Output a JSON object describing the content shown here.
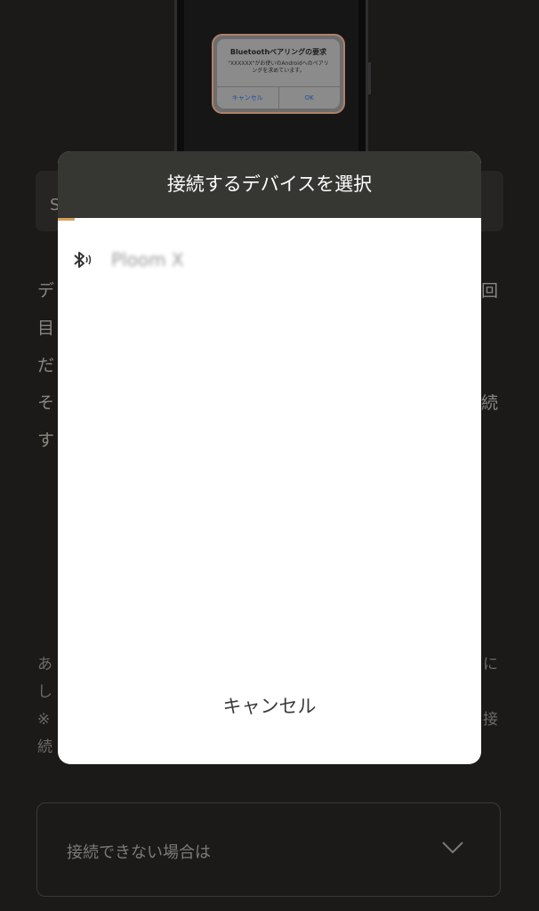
{
  "illustration": {
    "dialog_title": "Bluetoothペアリングの要求",
    "dialog_message": "\"XXXXXX\"がお使いのAndroidへのペアリングを求めています。",
    "cancel_label": "キャンセル",
    "ok_label": "OK"
  },
  "background": {
    "tab_text": "S",
    "paragraph_fragments": [
      "デ",
      "目",
      "だ",
      "そ",
      "す"
    ],
    "paragraph_right_fragments": [
      "回",
      "",
      "",
      "続",
      ""
    ],
    "note_fragments": [
      "あ",
      "し",
      "※",
      "続"
    ],
    "note_right_fragments": [
      "に",
      "",
      "接",
      ""
    ],
    "accordion_label": "接続できない場合は"
  },
  "modal": {
    "title": "接続するデバイスを選択",
    "devices": [
      {
        "name": "Ploom X",
        "icon": "bluetooth-icon"
      }
    ],
    "cancel_label": "キャンセル"
  },
  "colors": {
    "background": "#1b1a19",
    "modal_header": "#363633",
    "accent": "#d9a05a"
  }
}
